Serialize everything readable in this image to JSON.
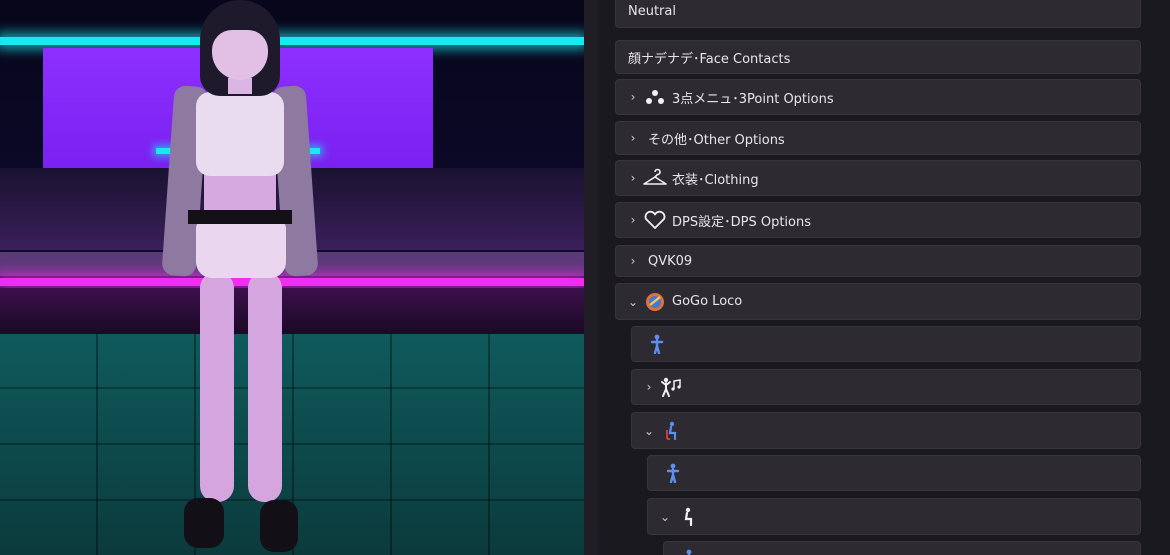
{
  "viewport": {
    "colors": {
      "neon_cyan": "#19e8f0",
      "neon_magenta": "#f02ef0",
      "panel_purple": "#8d30ff",
      "floor": "#0f5a5c"
    }
  },
  "menu": {
    "items": [
      {
        "label": "Neutral",
        "expandable": false,
        "icon": null
      },
      {
        "label": "顔ナデナデ･Face Contacts",
        "expandable": false,
        "icon": null
      },
      {
        "label": "3点メニュ･3Point Options",
        "expandable": true,
        "expanded": false,
        "icon": "three-dots-icon"
      },
      {
        "label": "その他･Other Options",
        "expandable": true,
        "expanded": false,
        "icon": null
      },
      {
        "label": "衣装･Clothing",
        "expandable": true,
        "expanded": false,
        "icon": "hanger-icon"
      },
      {
        "label": "DPS設定･DPS Options",
        "expandable": true,
        "expanded": false,
        "icon": "heart-icon"
      },
      {
        "label": "QVK09",
        "expandable": true,
        "expanded": false,
        "icon": null
      },
      {
        "label": "GoGo Loco",
        "expandable": true,
        "expanded": true,
        "icon": "gogo-loco-logo-icon"
      },
      {
        "label": "",
        "expandable": false,
        "icon": "standing-figure-icon"
      },
      {
        "label": "",
        "expandable": true,
        "expanded": false,
        "icon": "dancing-figure-icon"
      },
      {
        "label": "",
        "expandable": true,
        "expanded": true,
        "icon": "sitting-figure-icon"
      },
      {
        "label": "",
        "expandable": false,
        "icon": "standing-figure-icon"
      },
      {
        "label": "",
        "expandable": true,
        "expanded": true,
        "icon": "sitting-figure-icon"
      },
      {
        "label": "",
        "expandable": false,
        "icon": "standing-figure-icon"
      }
    ],
    "colors": {
      "row_bg": "#2d2a32",
      "panel_bg": "#1b1920",
      "text": "#e8e6ec",
      "figure_blue": "#4f7fe0"
    }
  }
}
